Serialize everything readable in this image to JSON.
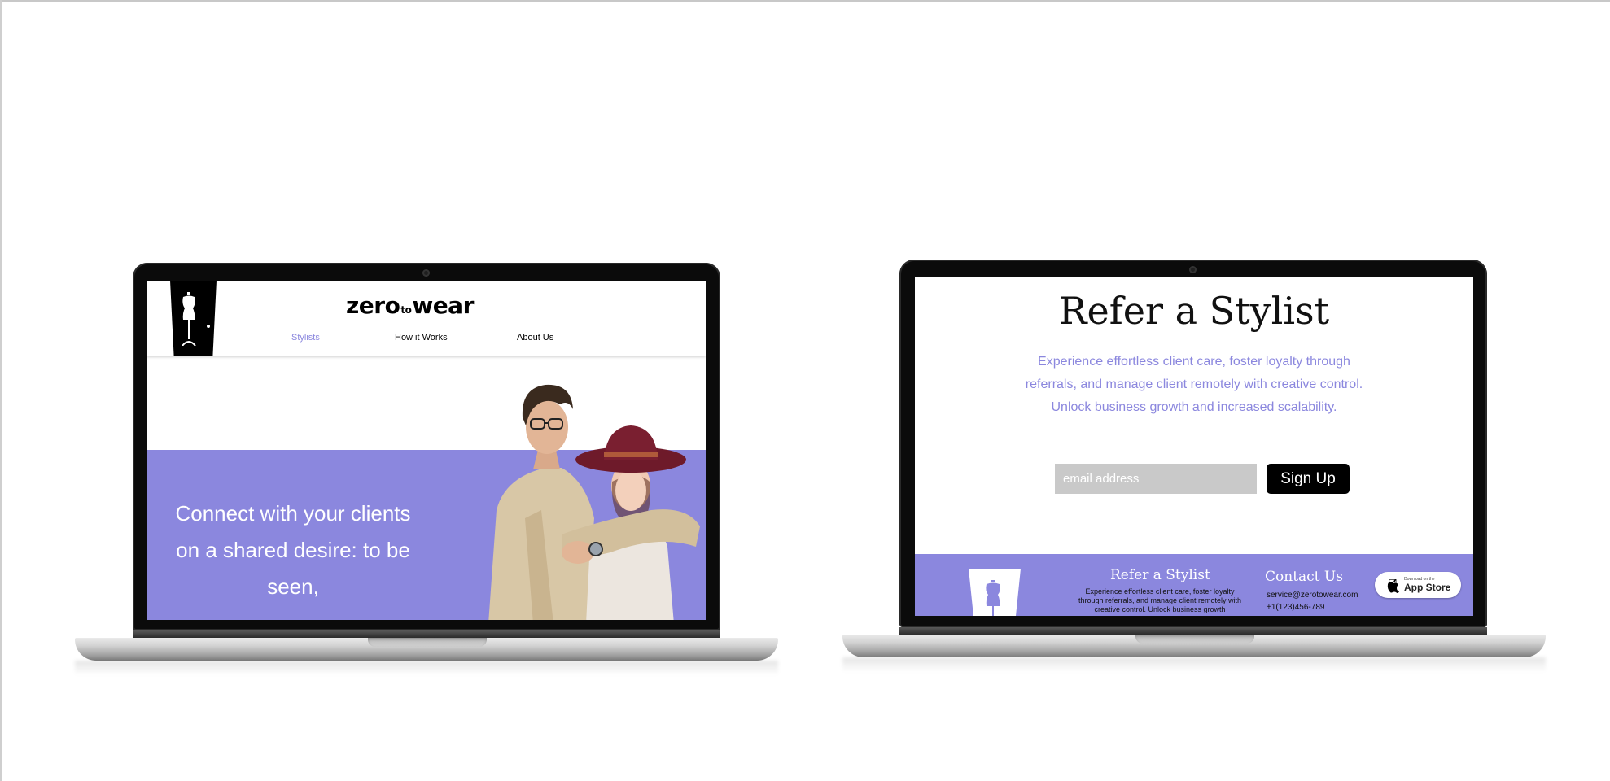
{
  "laptop_left": {
    "header": {
      "logo_zero": "zero",
      "logo_to": "to",
      "logo_wear": "wear",
      "nav": [
        {
          "label": "Stylists",
          "active": true
        },
        {
          "label": "How it Works",
          "active": false
        },
        {
          "label": "About Us",
          "active": false
        }
      ]
    },
    "hero": {
      "headline": "Connect with your clients on a shared desire: to be seen,"
    }
  },
  "laptop_right": {
    "title": "Refer a Stylist",
    "description": "Experience effortless client care, foster loyalty through referrals, and manage client remotely with creative control. Unlock business growth and increased scalability.",
    "email_placeholder": "email address",
    "signup_label": "Sign Up",
    "footer": {
      "title": "Refer a Stylist",
      "text": "Experience effortless client care, foster loyalty through referrals, and manage client remotely with creative control. Unlock business growth",
      "contact_title": "Contact Us",
      "email": "service@zerotowear.com",
      "phone": "+1(123)456-789",
      "appstore_small": "Download on the",
      "appstore_big": "App Store"
    }
  },
  "colors": {
    "accent": "#8b87de",
    "black": "#000000",
    "input_bg": "#c9c9c9"
  },
  "icons": [
    "dress-form-icon",
    "apple-icon",
    "door-icon"
  ]
}
